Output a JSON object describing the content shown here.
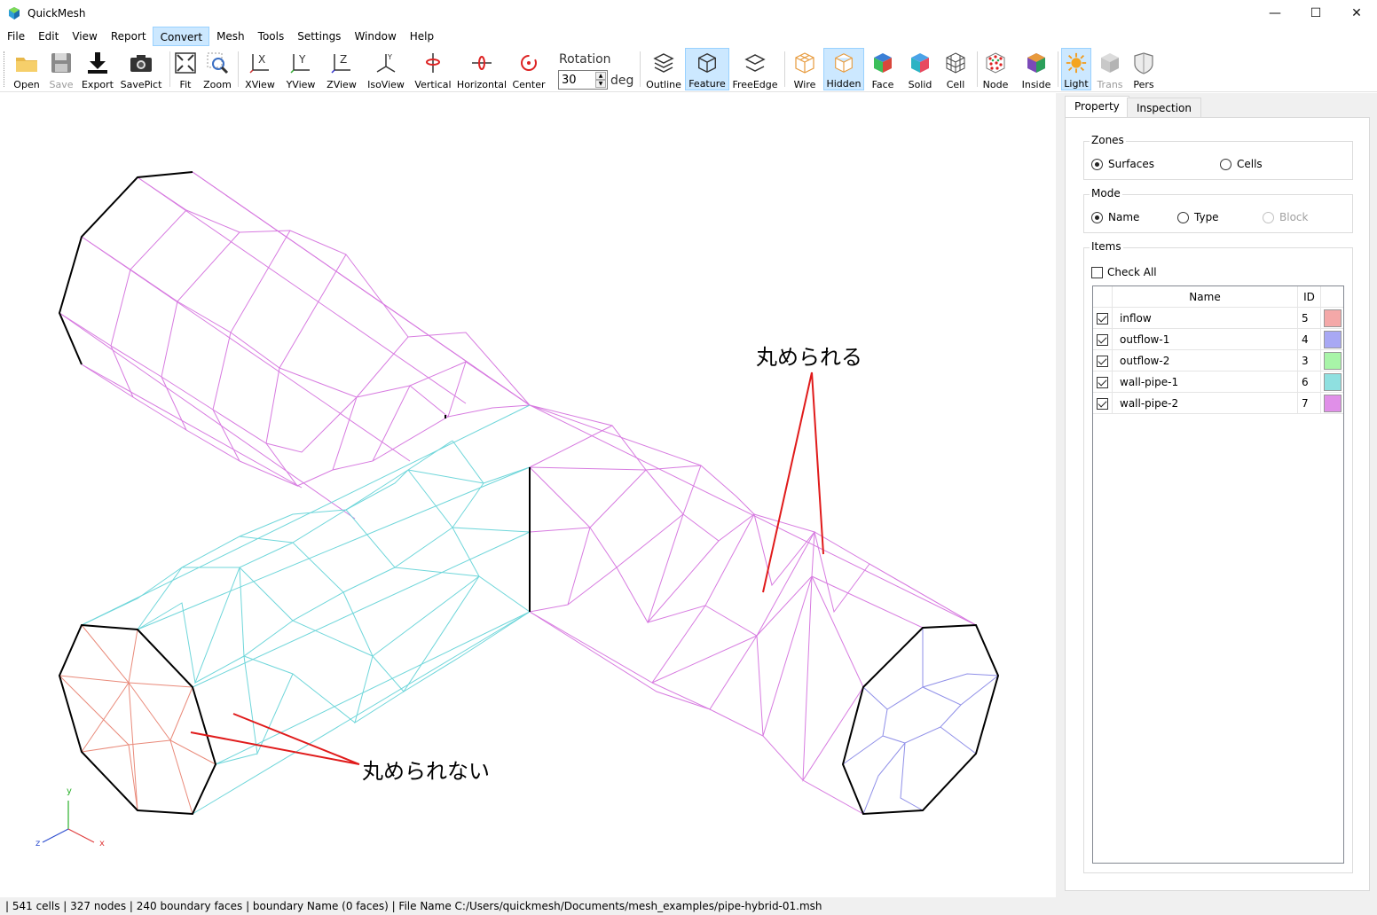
{
  "window": {
    "title": "QuickMesh",
    "minimize": "—",
    "maximize": "☐",
    "close": "✕"
  },
  "menu": [
    "File",
    "Edit",
    "View",
    "Report",
    "Convert",
    "Mesh",
    "Tools",
    "Settings",
    "Window",
    "Help"
  ],
  "menu_active": "Convert",
  "toolbar": {
    "open": "Open",
    "save": "Save",
    "export": "Export",
    "savepict": "SavePict",
    "fit": "Fit",
    "zoom": "Zoom",
    "xview": "XView",
    "yview": "YView",
    "zview": "ZView",
    "isoview": "IsoView",
    "vertical": "Vertical",
    "horizontal": "Horizontal",
    "center": "Center",
    "rotation_label": "Rotation",
    "rotation_value": "30",
    "deg": "deg",
    "outline": "Outline",
    "feature": "Feature",
    "freeedge": "FreeEdge",
    "wire": "Wire",
    "hidden": "Hidden",
    "face": "Face",
    "solid": "Solid",
    "cell": "Cell",
    "node": "Node",
    "inside": "Inside",
    "light": "Light",
    "trans": "Trans",
    "pers": "Pers"
  },
  "viewport": {
    "annotation_top": "丸められる",
    "annotation_bottom": "丸められない",
    "axis_y": "y",
    "axis_x": "x",
    "axis_z": "z",
    "colors": {
      "inflow": "#e98a7a",
      "wall_pipe_1": "#6fd6da",
      "wall_pipe_2": "#d77be0",
      "outflow": "#8f8fe8",
      "edge": "#000000",
      "annotation_line": "#e01b1b"
    }
  },
  "panel": {
    "tabs": [
      "Property",
      "Inspection"
    ],
    "zones": {
      "title": "Zones",
      "surfaces": "Surfaces",
      "cells": "Cells"
    },
    "mode": {
      "title": "Mode",
      "name": "Name",
      "type": "Type",
      "block": "Block"
    },
    "items": {
      "title": "Items",
      "check_all": "Check All",
      "header_name": "Name",
      "header_id": "ID",
      "rows": [
        {
          "name": "inflow",
          "id": "5",
          "color": "#f4a8a8"
        },
        {
          "name": "outflow-1",
          "id": "4",
          "color": "#a8a8f4"
        },
        {
          "name": "outflow-2",
          "id": "3",
          "color": "#a8f4a8"
        },
        {
          "name": "wall-pipe-1",
          "id": "6",
          "color": "#8fe0e0"
        },
        {
          "name": "wall-pipe-2",
          "id": "7",
          "color": "#e08fe8"
        }
      ]
    }
  },
  "status": "| 541 cells | 327 nodes | 240 boundary faces |  boundary Name  (0 faces) | File Name C:/Users/quickmesh/Documents/mesh_examples/pipe-hybrid-01.msh"
}
